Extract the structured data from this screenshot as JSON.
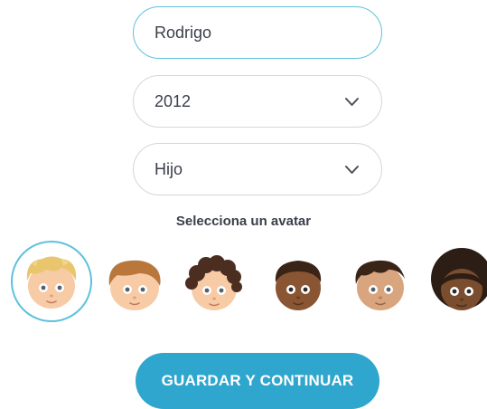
{
  "form": {
    "name_value": "Rodrigo",
    "year_value": "2012",
    "relation_value": "Hijo",
    "avatar_title": "Selecciona un avatar",
    "save_label": "GUARDAR Y CONTINUAR",
    "accent_color": "#2fa6cd"
  },
  "avatars": [
    {
      "name": "avatar-blond",
      "skin": "#f7cba6",
      "hair": "#e9c66e",
      "selected": true
    },
    {
      "name": "avatar-light-brown",
      "skin": "#f7cba6",
      "hair": "#b9773c",
      "selected": false
    },
    {
      "name": "avatar-curly-brown",
      "skin": "#f7cba6",
      "hair": "#4b2e20",
      "selected": false
    },
    {
      "name": "avatar-dark-skin",
      "skin": "#8a5532",
      "hair": "#3a2417",
      "selected": false
    },
    {
      "name": "avatar-tan-skin",
      "skin": "#d8a57e",
      "hair": "#3a2417",
      "selected": false
    },
    {
      "name": "avatar-afro",
      "skin": "#7a4d2e",
      "hair": "#2c1d15",
      "selected": false
    }
  ]
}
